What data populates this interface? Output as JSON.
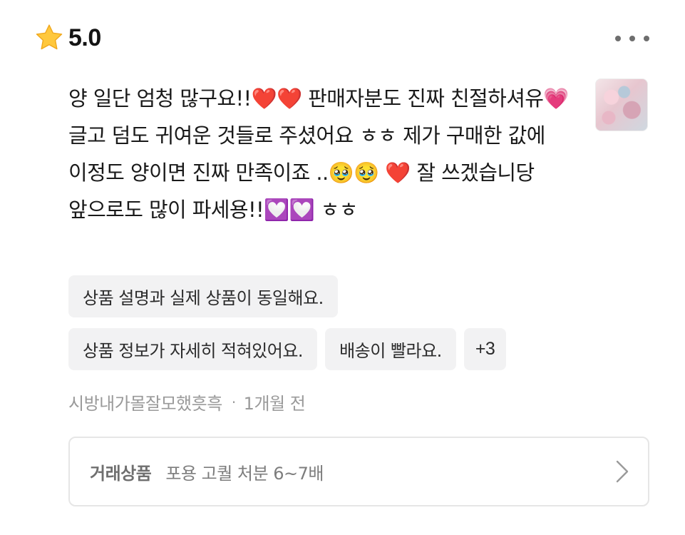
{
  "review": {
    "rating": "5.0",
    "rating_icon": "star-icon",
    "more_icon": "more-horizontal-icon",
    "text": "양 일단 엄청 많구요!!❤️❤️ 판매자분도 진짜 친절하셔유💗 글고 덤도 귀여운 것들로 주셨어요 ㅎㅎ 제가 구매한 값에 이정도 양이면 진짜 만족이죠 ..🥹🥹 ❤️ 잘 쓰겠습니당 앞으로도 많이 파세용!!💟💟 ㅎㅎ",
    "thumbnail_icon": "review-photo-thumbnail",
    "tags_row1": [
      "상품 설명과 실제 상품이 동일해요."
    ],
    "tags_row2": [
      "상품 정보가 자세히 적혀있어요.",
      "배송이 빨라요."
    ],
    "more_tags": "+3",
    "author": "시방내가몰잘모했흣흑",
    "separator": "·",
    "time": "1개월 전",
    "product": {
      "label": "거래상품",
      "name": "포용 고퀄 처분 6~7배",
      "chevron_icon": "chevron-right-icon"
    }
  },
  "colors": {
    "star": "#FFC83D",
    "chip_bg": "#F2F2F3",
    "meta_text": "#9A9A9A",
    "border": "#E6E6E6"
  }
}
